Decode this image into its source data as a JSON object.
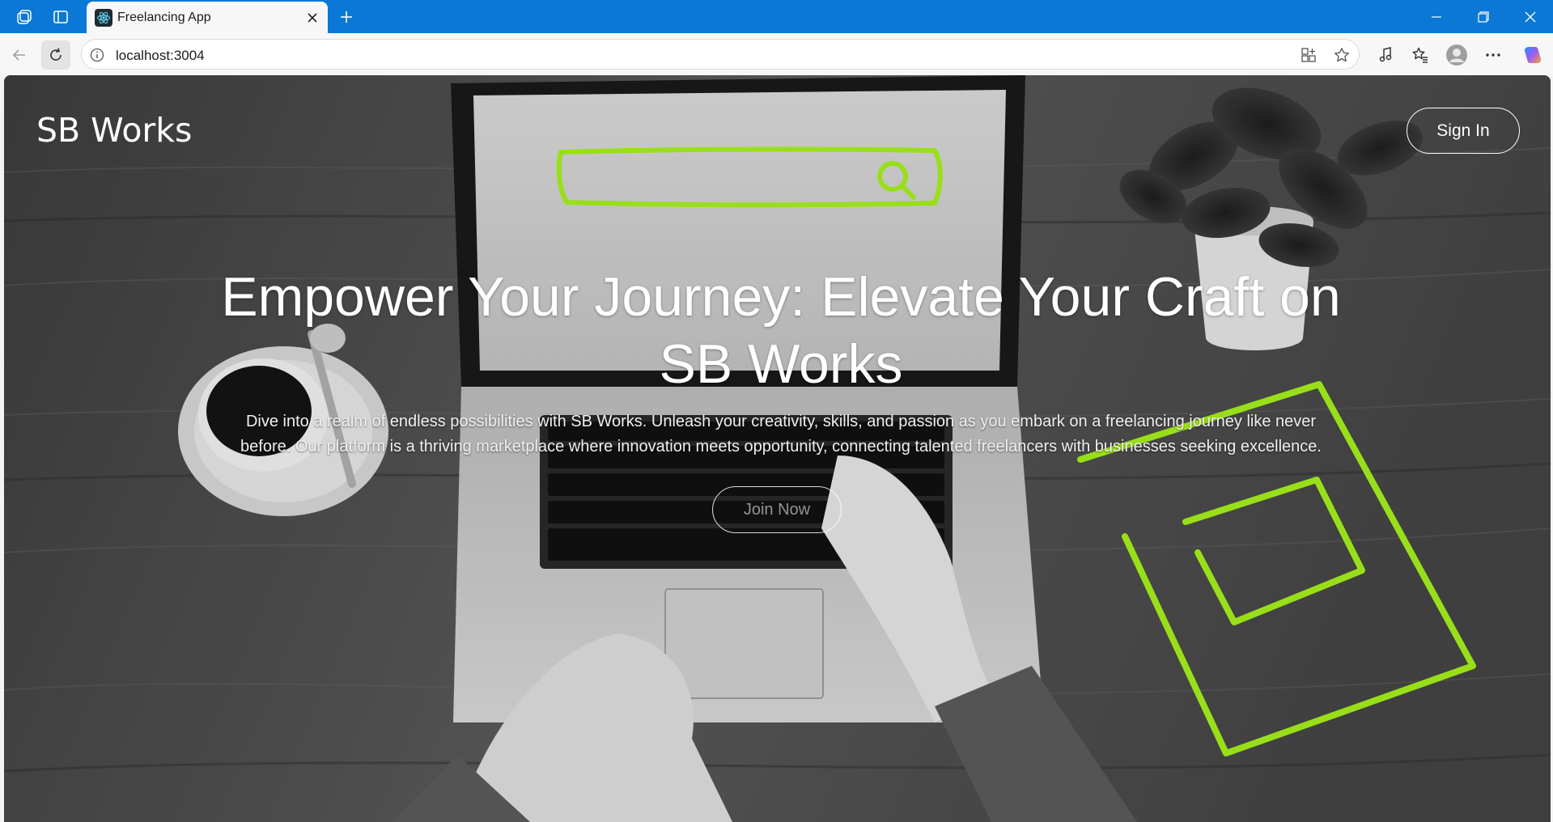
{
  "browser": {
    "tab_title": "Freelancing App",
    "url": "localhost:3004"
  },
  "page": {
    "brand": "SB Works",
    "signin_label": "Sign In",
    "hero_title": "Empower Your Journey: Elevate Your Craft on SB Works",
    "hero_subtitle": "Dive into a realm of endless possibilities with SB Works. Unleash your creativity, skills, and passion as you embark on a freelancing journey like never before. Our platform is a thriving marketplace where innovation meets opportunity, connecting talented freelancers with businesses seeking excellence.",
    "join_label": "Join Now"
  },
  "colors": {
    "titlebar": "#0a78d4",
    "accent_green": "#a6f21c"
  }
}
